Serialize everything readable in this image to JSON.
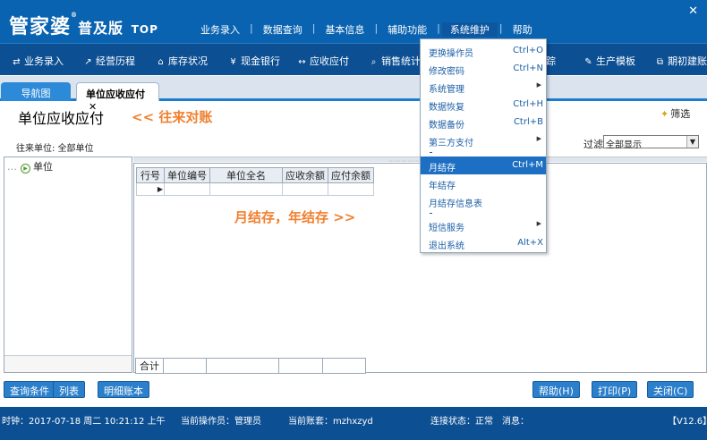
{
  "app": {
    "logo_main": "管家婆",
    "logo_edition": "普及版",
    "logo_suffix": "TOP",
    "reg_mark": "®",
    "close_glyph": "✕"
  },
  "top_menu": [
    "业务录入",
    "数据查询",
    "基本信息",
    "辅助功能",
    "系统维护",
    "帮助"
  ],
  "menu_separator": "|",
  "toolbar": [
    {
      "label": "业务录入",
      "icon": "document-import-icon"
    },
    {
      "label": "经营历程",
      "icon": "chart-icon"
    },
    {
      "label": "库存状况",
      "icon": "warehouse-icon"
    },
    {
      "label": "现金银行",
      "icon": "yen-icon"
    },
    {
      "label": "应收应付",
      "icon": "exchange-icon"
    },
    {
      "label": "销售统计",
      "icon": "search-icon"
    },
    {
      "label": "踪",
      "icon": ""
    },
    {
      "label": "生产模板",
      "icon": "wrench-icon"
    },
    {
      "label": "期初建账",
      "icon": "external-icon"
    }
  ],
  "tabs": {
    "nav": "导航图",
    "current": "单位应收应付",
    "close": "✕"
  },
  "page": {
    "title": "单位应收应付",
    "annotation1": "<< 往来对账",
    "filter_button": "筛选",
    "unit_label": "往来单位: 全部单位",
    "filter_label": "过滤",
    "filter_value": "全部显示",
    "annotation2": "月结存，年结存 >>"
  },
  "tree": {
    "root": "单位"
  },
  "grid": {
    "columns": [
      "行号",
      "单位编号",
      "单位全名",
      "应收余额",
      "应付余额"
    ],
    "row_pointer": "▶",
    "total_label": "合计"
  },
  "buttons": {
    "query": "查询条件",
    "list": "列表",
    "detail": "明细账本",
    "help": "帮助(H)",
    "print": "打印(P)",
    "close": "关闭(C)"
  },
  "status": {
    "clock": "时钟：2017-07-18 周二 10:21:12 上午",
    "operator": "当前操作员：管理员",
    "account": "当前账套：mzhxzyd",
    "connection": "连接状态：正常",
    "message": "消息：",
    "version": "【V12.6】"
  },
  "dropdown": [
    {
      "label": "更换操作员",
      "shortcut": "Ctrl+O"
    },
    {
      "label": "修改密码",
      "shortcut": "Ctrl+N"
    },
    {
      "label": "系统管理",
      "submenu": true
    },
    {
      "label": "数据恢复",
      "shortcut": "Ctrl+H"
    },
    {
      "label": "数据备份",
      "shortcut": "Ctrl+B"
    },
    {
      "label": "第三方支付",
      "submenu": true
    },
    {
      "label": "月结存",
      "shortcut": "Ctrl+M",
      "highlighted": true
    },
    {
      "label": "年结存"
    },
    {
      "label": "月结存信息表"
    },
    {
      "label": "短信服务",
      "submenu": true
    },
    {
      "label": "退出系统",
      "shortcut": "Alt+X"
    }
  ],
  "colors": {
    "title_bar": "#0a63b0",
    "toolbar": "#0c4f93",
    "accent_annotation": "#f08030",
    "menu_highlight": "#1d6fc3"
  }
}
